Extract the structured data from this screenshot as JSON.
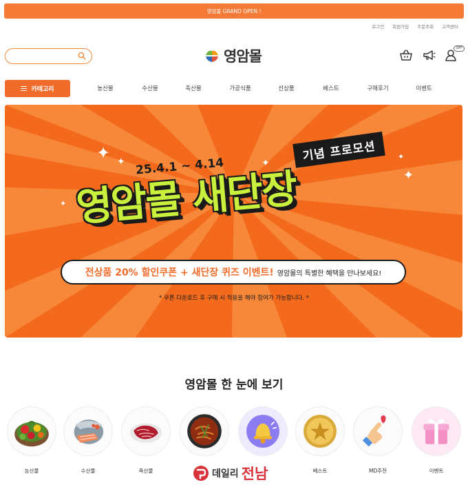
{
  "topbar": {
    "text": "영암몰 GRAND OPEN !"
  },
  "util_links": [
    "로그인",
    "회원가입",
    "주문조회",
    "고객센터"
  ],
  "search": {
    "placeholder": ""
  },
  "logo": {
    "text": "영암몰"
  },
  "header_icons": {
    "cart": "basket-icon",
    "notice": "megaphone-icon",
    "user": "user-icon",
    "user_badge": "OFF"
  },
  "category_button": {
    "label": "카테고리"
  },
  "nav": [
    "농산물",
    "수산물",
    "축산물",
    "가공식품",
    "선상품",
    "베스트",
    "구매후기",
    "이벤트"
  ],
  "banner": {
    "tag": "기념 프로모션",
    "date": "25.4.1 ~ 4.14",
    "headline": "영암몰 새단장",
    "pill_highlight": "전상품 20% 할인쿠폰 + 새단장 퀴즈 이벤트!",
    "pill_text": "영암몰의 특별한 혜택을 만나보세요!",
    "notice": "* 쿠폰 다운로드 후 구매 시 적용을 해야 참여가 가능합니다. *",
    "colors": {
      "background": "#f46a1c",
      "headline": "#c8f03c",
      "accent": "#f16c2a"
    }
  },
  "section": {
    "title": "영암몰 한 눈에 보기"
  },
  "quick_links": [
    "농산물",
    "수산물",
    "축산물",
    "",
    "",
    "베스트",
    "MD추천",
    "이벤트"
  ],
  "watermark": {
    "part1": "데일리",
    "part2": "전남"
  }
}
